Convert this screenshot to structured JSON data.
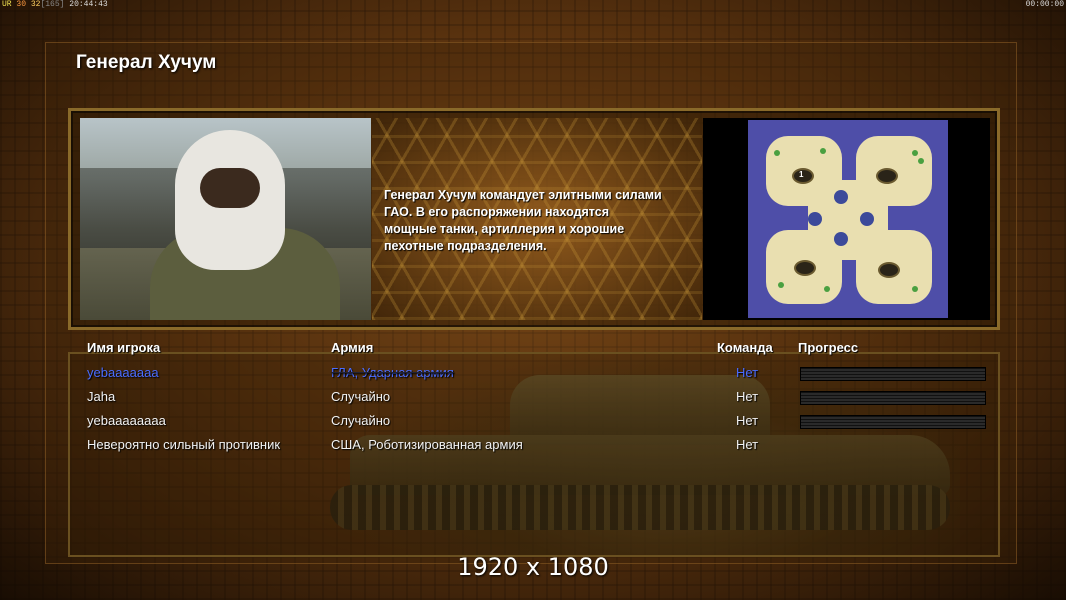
{
  "hud": {
    "ur": "UR",
    "n1": "30",
    "n2": "32",
    "n3": "[165]",
    "clock": "20:44:43",
    "timer": "00:00:00"
  },
  "title": "Генерал Хучум",
  "description": "Генерал Хучум командует элитными силами\n ГАО. В его распоряжении находятся\n мощные танки, артиллерия и хорошие\n пехотные подразделения.",
  "minimap": {
    "slot_1": "1",
    "colors": {
      "water": "#4e4ea8",
      "land": "#e9dfb0"
    }
  },
  "table": {
    "headers": {
      "player": "Имя игрока",
      "army": "Армия",
      "team": "Команда",
      "progress": "Прогресс"
    },
    "rows": [
      {
        "player": "yebaaaaaaa",
        "army": "ГЛА, Ударная армия",
        "team": "Нет",
        "progress": 0,
        "highlight": true
      },
      {
        "player": "Jaha",
        "army": "Случайно",
        "team": "Нет",
        "progress": 0,
        "highlight": false
      },
      {
        "player": "yebaaaaaaaa",
        "army": "Случайно",
        "team": "Нет",
        "progress": 0,
        "highlight": false
      },
      {
        "player": "Невероятно сильный противник",
        "army": "США, Роботизированная армия",
        "team": "Нет",
        "progress": null,
        "highlight": false
      }
    ]
  },
  "resolution_label": "1920 x 1080",
  "colors": {
    "accent_blue": "#4a6cff",
    "frame": "#8a6a2a"
  }
}
